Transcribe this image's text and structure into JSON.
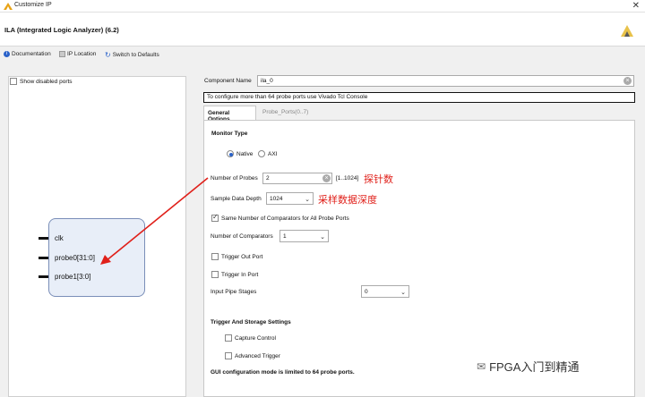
{
  "window": {
    "title": "Customize IP"
  },
  "header": {
    "ip_title": "ILA (Integrated Logic Analyzer) (6.2)"
  },
  "toolbar": {
    "documentation": "Documentation",
    "ip_location": "IP Location",
    "switch_defaults": "Switch to Defaults"
  },
  "left": {
    "show_disabled": "Show disabled ports",
    "pins": [
      "clk",
      "probe0[31:0]",
      "probe1[3:0]"
    ]
  },
  "form": {
    "component_name_label": "Component Name",
    "component_name_value": "ila_0",
    "note": "To configure more than 64 probe ports use Vivado Tcl Console",
    "tabs": [
      "General Options",
      "Probe_Ports(0..7)"
    ],
    "monitor_type_title": "Monitor Type",
    "native_label": "Native",
    "axi_label": "AXI",
    "num_probes_label": "Number of Probes",
    "num_probes_value": "2",
    "num_probes_range": "[1..1024]",
    "depth_label": "Sample Data Depth",
    "depth_value": "1024",
    "same_comparators_label": "Same Number of Comparators for All Probe Ports",
    "num_comparators_label": "Number of Comparators",
    "num_comparators_value": "1",
    "trigger_out_label": "Trigger Out Port",
    "trigger_in_label": "Trigger In Port",
    "input_pipe_label": "Input Pipe Stages",
    "input_pipe_value": "0",
    "trigger_storage_title": "Trigger And Storage Settings",
    "capture_control_label": "Capture Control",
    "advanced_trigger_label": "Advanced Trigger",
    "gui_limit_note": "GUI configuration mode is limited to 64 probe ports."
  },
  "annotations": {
    "probes_cn": "探针数",
    "depth_cn": "采样数据深度"
  },
  "watermark": {
    "text": "FPGA入门到精通"
  },
  "colors": {
    "annotation": "#e0201a",
    "accent": "#2a62c9"
  }
}
